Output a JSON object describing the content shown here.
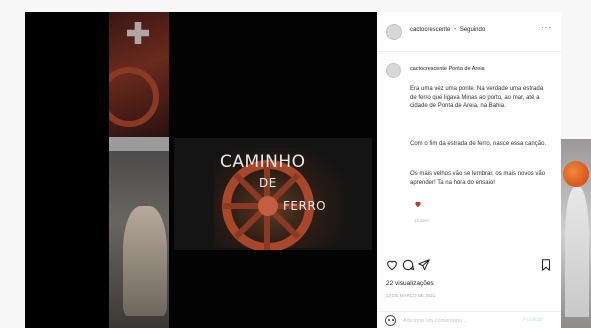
{
  "post": {
    "title_line1": "Caminho",
    "title_line2": "de",
    "title_line3": "ferro"
  },
  "header": {
    "username": "cactocrescente",
    "separator": "•",
    "follow_status": "Seguindo",
    "more": "···"
  },
  "caption": {
    "user_line": "cactocrescente Ponta de Areia",
    "paragraphs": [
      "Era uma vez uma ponte. Na verdade uma estrada de ferro que ligava Minas ao porto, ao mar, até a cidade de Ponta de Areia, na Bahia.",
      "Com o fim da estrada de ferro, nasce essa canção.",
      "Os mais velhos vão se lembrar, os mais novos vão aprender! Ta na hora do ensaio!"
    ],
    "time": "12 sem"
  },
  "stats": {
    "views": "22 visualizações",
    "date": "13 DE MARÇO DE 2021"
  },
  "comment_box": {
    "placeholder": "Adicione um comentário...",
    "publish_label": "Publicar"
  },
  "colors": {
    "like": "#c0392b",
    "publish": "#c5dff8"
  }
}
